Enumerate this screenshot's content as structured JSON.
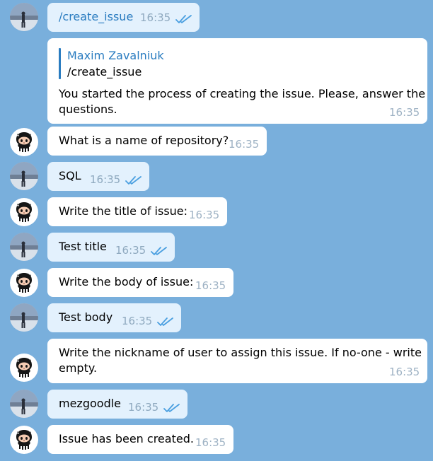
{
  "messages": [
    {
      "text": "/create_issue",
      "time": "16:35",
      "sender": "user",
      "read": true
    },
    {
      "reply_to_name": "Maxim Zavalniuk",
      "reply_to_text": "/create_issue",
      "text_line1": "You started the process of creating the issue. Please, answer the",
      "text_line2": "questions.",
      "time": "16:35",
      "sender": "bot"
    },
    {
      "text": "What is a name of repository?",
      "time": "16:35",
      "sender": "bot"
    },
    {
      "text": "SQL",
      "time": "16:35",
      "sender": "user",
      "read": true
    },
    {
      "text": "Write the title of issue:",
      "time": "16:35",
      "sender": "bot"
    },
    {
      "text": "Test title",
      "time": "16:35",
      "sender": "user",
      "read": true
    },
    {
      "text": "Write the body of issue:",
      "time": "16:35",
      "sender": "bot"
    },
    {
      "text": "Test body",
      "time": "16:35",
      "sender": "user",
      "read": true
    },
    {
      "text_line1": "Write the nickname of user to assign this issue. If no-one - write",
      "text_line2": "empty.",
      "time": "16:35",
      "sender": "bot"
    },
    {
      "text": "mezgoodle",
      "time": "16:35",
      "sender": "user",
      "read": true
    },
    {
      "text": "Issue has been created.",
      "time": "16:35",
      "sender": "bot"
    }
  ],
  "colors": {
    "background": "#79afdc",
    "outgoing_bubble": "#e3f1fd",
    "incoming_bubble": "#ffffff",
    "accent": "#2a7cc0",
    "check": "#4a9fe0"
  },
  "icons": {
    "user_avatar": "user-photo-avatar",
    "bot_avatar": "github-octocat-avatar",
    "read_receipt": "double-check-icon"
  }
}
